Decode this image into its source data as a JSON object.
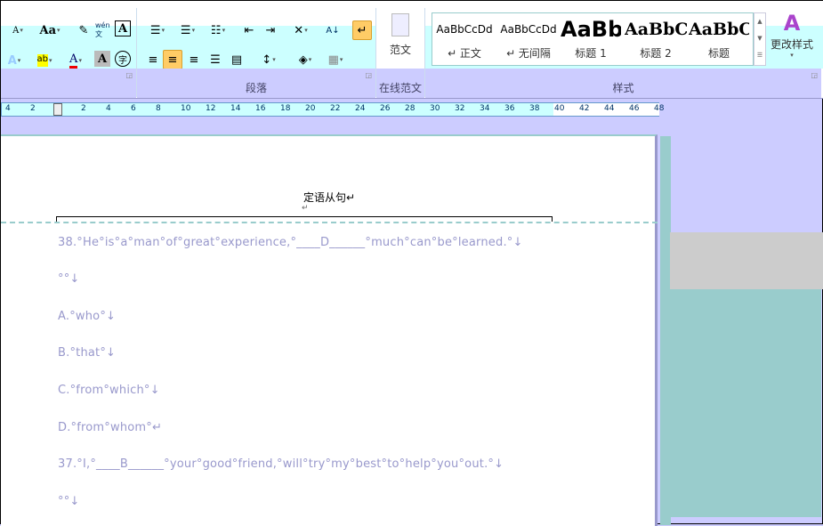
{
  "ribbon": {
    "font_buttons": [
      "A",
      "Aa",
      "wén文",
      "A",
      "A",
      "ab",
      "A",
      "A",
      "字"
    ],
    "paragraph_label": "段落",
    "online_label": "在线范文",
    "fanwen_button": "范文",
    "styles_label": "样式",
    "change_styles": "更改样式",
    "styles": [
      {
        "sample": "AaBbCcDd",
        "label": "↵ 正文"
      },
      {
        "sample": "AaBbCcDd",
        "label": "↵ 无间隔"
      },
      {
        "sample": "AaBb",
        "label": "标题 1"
      },
      {
        "sample": "AaBbC",
        "label": "标题 2"
      },
      {
        "sample": "AaBbC",
        "label": "标题"
      }
    ]
  },
  "ruler": {
    "left": [
      "4",
      "2"
    ],
    "ticks": [
      "2",
      "4",
      "6",
      "8",
      "10",
      "12",
      "14",
      "16",
      "18",
      "20",
      "22",
      "24",
      "26",
      "28",
      "30",
      "32",
      "34",
      "36",
      "38",
      "40",
      "42",
      "44",
      "46",
      "48"
    ]
  },
  "document": {
    "header": "定语从句↵",
    "header_mark": "↵",
    "lines": [
      "38.°He°is°a°man°of°great°experience,°____D______°much°can°be°learned.°↓",
      "°°↓",
      "A.°who°↓",
      "B.°that°↓",
      "C.°from°which°↓",
      "D.°from°whom°↵",
      "37.°I,°____B______°your°good°friend,°will°try°my°best°to°help°you°out.°↓",
      "°°↓"
    ]
  }
}
